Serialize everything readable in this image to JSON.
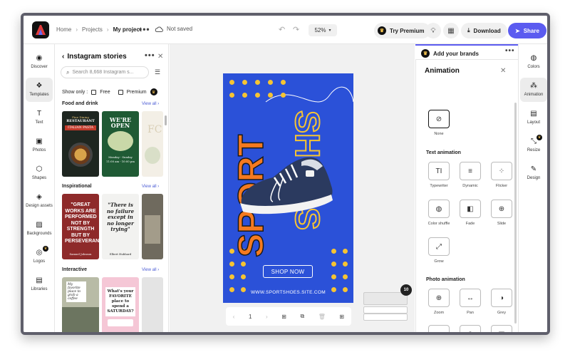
{
  "topbar": {
    "breadcrumbs": [
      "Home",
      "Projects",
      "My project"
    ],
    "more_label": "•••",
    "save_status": "Not saved",
    "zoom": "52%",
    "try_premium": "Try Premium",
    "download": "Download",
    "share": "Share"
  },
  "rail": {
    "items": [
      {
        "label": "Discover",
        "icon": "compass-icon"
      },
      {
        "label": "Templates",
        "icon": "templates-icon"
      },
      {
        "label": "Text",
        "icon": "text-icon"
      },
      {
        "label": "Photos",
        "icon": "photo-icon"
      },
      {
        "label": "Shapes",
        "icon": "shapes-icon"
      },
      {
        "label": "Design assets",
        "icon": "design-assets-icon"
      },
      {
        "label": "Backgrounds",
        "icon": "backgrounds-icon"
      },
      {
        "label": "Logos",
        "icon": "logos-icon"
      },
      {
        "label": "Libraries",
        "icon": "libraries-icon"
      }
    ],
    "active": "Templates"
  },
  "panel": {
    "title": "Instagram stories",
    "search_placeholder": "Search 8,668 Instagram s...",
    "show_only": "Show only :",
    "free": "Free",
    "premium": "Premium",
    "sections": [
      {
        "title": "Food and drink",
        "view_all": "View all"
      },
      {
        "title": "Inspirational",
        "view_all": "View all"
      },
      {
        "title": "Interactive",
        "view_all": "View all"
      }
    ],
    "thumbs": {
      "food1": {
        "top": "Fine Dining",
        "name": "RESTAURANT",
        "dish": "ITALIAN PASTA"
      },
      "food2": {
        "headline": "WE'RE OPEN",
        "line1": "Monday - Sunday",
        "line2": "11:00 am - 10:00 pm"
      },
      "inspo1": {
        "quote": "\"GREAT WORKS ARE PERFORMED NOT BY STRENGTH BUT BY PERSEVERANCE\"",
        "author": "Samuel Johnson"
      },
      "inspo2": {
        "quote": "\"There is no failure except in no longer trying\"",
        "author": "Elbert Hubbard"
      },
      "inter1": {
        "text": "My favorite place to grab a coffee"
      },
      "inter2": {
        "text": "What's your FAVORITE place to spend a SATURDAY?"
      }
    }
  },
  "poster": {
    "word1": "SPORT",
    "word2": "SHOES",
    "cta": "SHOP NOW",
    "site": "WWW.SPORTSHOES.SITE.COM",
    "colors": {
      "bg": "#2b51d8",
      "accent_orange": "#f47a20",
      "accent_yellow": "#f6c433"
    }
  },
  "pagebar": {
    "page": "1"
  },
  "pages_count": "10",
  "brands": {
    "title": "Add your brands"
  },
  "animation": {
    "title": "Animation",
    "none": "None",
    "text_animation": "Text animation",
    "text_items": [
      "Typewriter",
      "Dynamic",
      "Flicker",
      "Color shuffle",
      "Fade",
      "Slide",
      "Grow"
    ],
    "photo_animation": "Photo animation",
    "photo_items": [
      "Zoom",
      "Pan",
      "Grey"
    ]
  },
  "rrail": {
    "items": [
      {
        "label": "Colors",
        "icon": "palette-icon"
      },
      {
        "label": "Animation",
        "icon": "animation-icon"
      },
      {
        "label": "Layout",
        "icon": "layout-icon"
      },
      {
        "label": "Resize",
        "icon": "resize-icon"
      },
      {
        "label": "Design",
        "icon": "design-icon"
      }
    ],
    "active": "Animation"
  }
}
